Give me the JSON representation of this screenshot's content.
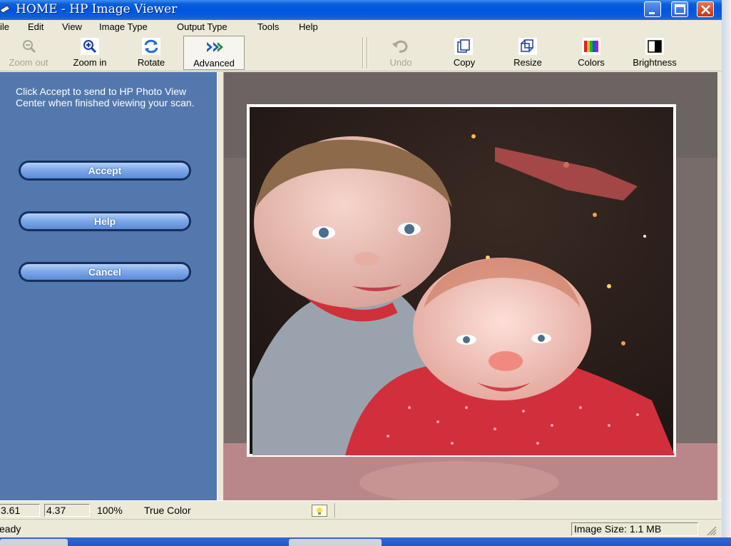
{
  "window": {
    "title": "HOME - HP Image Viewer"
  },
  "menu": [
    "File",
    "Edit",
    "View",
    "Image Type",
    "Output Type",
    "Tools",
    "Help"
  ],
  "toolbar": {
    "zoom_out": "Zoom out",
    "zoom_in": "Zoom in",
    "rotate": "Rotate",
    "advanced": "Advanced",
    "undo": "Undo",
    "copy": "Copy",
    "resize": "Resize",
    "colors": "Colors",
    "brightness": "Brightness"
  },
  "panel": {
    "message": "Click Accept to send to HP Photo View Center when finished viewing your scan.",
    "accept": "Accept",
    "help": "Help",
    "cancel": "Cancel"
  },
  "status": {
    "x": "3.61",
    "y": "4.37",
    "zoom": "100%",
    "color_mode": "True Color",
    "ready": "eady",
    "image_size": "Image Size:  1.1 MB"
  },
  "colors": {
    "panel_blue": "#5378ad",
    "title_blue": "#0054e3",
    "button_blue": "#7ea9ea"
  },
  "icons": [
    "scanner-icon",
    "zoom-out-icon",
    "zoom-in-icon",
    "rotate-icon",
    "advanced-icon",
    "undo-icon",
    "copy-icon",
    "resize-icon",
    "colors-icon",
    "brightness-icon",
    "tip-icon"
  ]
}
